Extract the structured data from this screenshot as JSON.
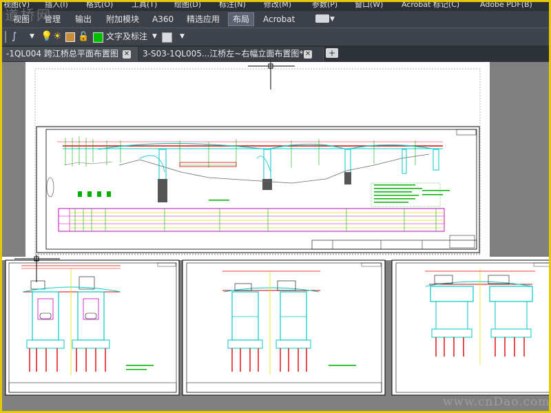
{
  "menubar": {
    "items": [
      "视图(V)",
      "插入(I)",
      "格式(O)",
      "工具(T)",
      "绘图(D)",
      "标注(N)",
      "修改(M)",
      "参数(P)",
      "窗口(W)",
      "Acrobat 标记(C)",
      "Adobe PDF(B)"
    ]
  },
  "ribbon": {
    "tabs": [
      "视图",
      "管理",
      "输出",
      "附加模块",
      "A360",
      "精选应用",
      "布局",
      "Acrobat"
    ],
    "active_tab": "布局"
  },
  "toolbar": {
    "annotation_label": "文字及标注",
    "layer_color": "#00c000"
  },
  "file_tabs": [
    {
      "label": "-1QL004 跨江桥总平面布置图"
    },
    {
      "label": "3-S03-1QL005...江桥左~右幅立面布置图*"
    }
  ],
  "watermarks": {
    "top_left": "道桥网",
    "bottom_right": "www.cnDao.com"
  },
  "colors": {
    "window_border": "#e6c800",
    "canvas_bg": "#808080",
    "drawing_cyan": "#00c8c8",
    "drawing_red": "#e00000",
    "drawing_green": "#00b000",
    "drawing_magenta": "#c000c0",
    "drawing_yellow": "#e0e000"
  }
}
